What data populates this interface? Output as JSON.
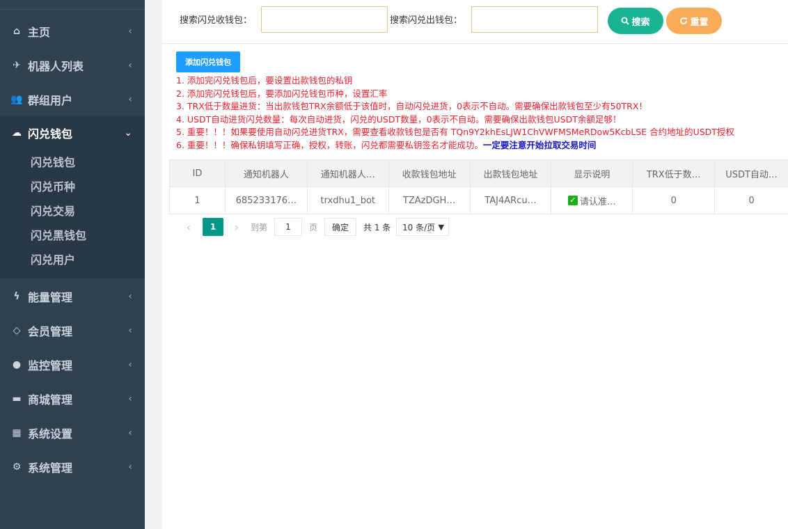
{
  "sidebar": {
    "items": [
      {
        "label": "主页",
        "icon": "home-icon",
        "glyph": "⌂",
        "chevron": "‹"
      },
      {
        "label": "机器人列表",
        "icon": "plane-icon",
        "glyph": "✈",
        "chevron": "‹"
      },
      {
        "label": "群组用户",
        "icon": "users-icon",
        "glyph": "👥",
        "chevron": "‹"
      },
      {
        "label": "闪兑钱包",
        "icon": "cloud-icon",
        "glyph": "☁",
        "chevron": "⌄"
      },
      {
        "label": "能量管理",
        "icon": "bolt-icon",
        "glyph": "ϟ",
        "chevron": "‹"
      },
      {
        "label": "会员管理",
        "icon": "diamond-icon",
        "glyph": "◇",
        "chevron": "‹"
      },
      {
        "label": "监控管理",
        "icon": "drop-icon",
        "glyph": "●",
        "chevron": "‹"
      },
      {
        "label": "商城管理",
        "icon": "cart-icon",
        "glyph": "▬",
        "chevron": "‹"
      },
      {
        "label": "系统设置",
        "icon": "windows-icon",
        "glyph": "▦",
        "chevron": "‹"
      },
      {
        "label": "系统管理",
        "icon": "gear-icon",
        "glyph": "⚙",
        "chevron": "‹"
      }
    ],
    "submenu": [
      "闪兑钱包",
      "闪兑币种",
      "闪兑交易",
      "闪兑黑钱包",
      "闪兑用户"
    ],
    "active_color": "#293846"
  },
  "search": {
    "receive_label": "搜索闪兑收钱包：",
    "send_label": "搜索闪兑出钱包：",
    "receive_value": "",
    "send_value": "",
    "search_label": "搜索",
    "reset_label": "重置",
    "search_icon": "search-icon",
    "reset_icon": "refresh-icon"
  },
  "add_button": "添加闪兑钱包",
  "notes": [
    "1. 添加完闪兑钱包后，要设置出款钱包的私钥",
    "2. 添加完闪兑钱包后，要添加闪兑钱包币种，设置汇率",
    "3. TRX低于数量进货：当出款钱包TRX余额低于该值时，自动闪兑进货，0表示不自动。需要确保出款钱包至少有50TRX！",
    "4. USDT自动进货闪兑数量：每次自动进货，闪兑的USDT数量，0表示不自动。需要确保出款钱包USDT余额足够！",
    "5. 重要！！！如果要使用自动闪兑进货TRX，需要查看收款钱包是否有 TQn9Y2khEsLJW1ChVWFMSMeRDow5KcbLSE 合约地址的USDT授权",
    "6. 重要！！！确保私钥填写正确，授权，转账，闪兑都需要私钥签名才能成功。"
  ],
  "note6_emphasis": "一定要注意开始拉取交易时间",
  "table": {
    "headers": [
      "ID",
      "通知机器人",
      "通知机器人…",
      "收款钱包地址",
      "出款钱包地址",
      "显示说明",
      "TRX低于数…",
      "USDT自动…"
    ],
    "rows": [
      [
        "1",
        "685233176…",
        "trxdhu1_bot",
        "TZAzDGH…",
        "TAJ4ARcu…",
        "请认准…",
        "0",
        "0"
      ]
    ]
  },
  "pagination": {
    "prev": "‹",
    "current": "1",
    "next": "›",
    "goto_label": "到第",
    "goto_value": "1",
    "page_unit": "页",
    "confirm": "确定",
    "total": "共 1 条",
    "page_size": "10 条/页"
  },
  "colors": {
    "sidebar_bg": "#2f4050",
    "search_btn": "#1ab394",
    "reset_btn": "#f8ac59",
    "add_btn": "#1e9fff",
    "note_red": "#e8212e",
    "note_blue": "#1414c8",
    "page_current": "#009688"
  }
}
